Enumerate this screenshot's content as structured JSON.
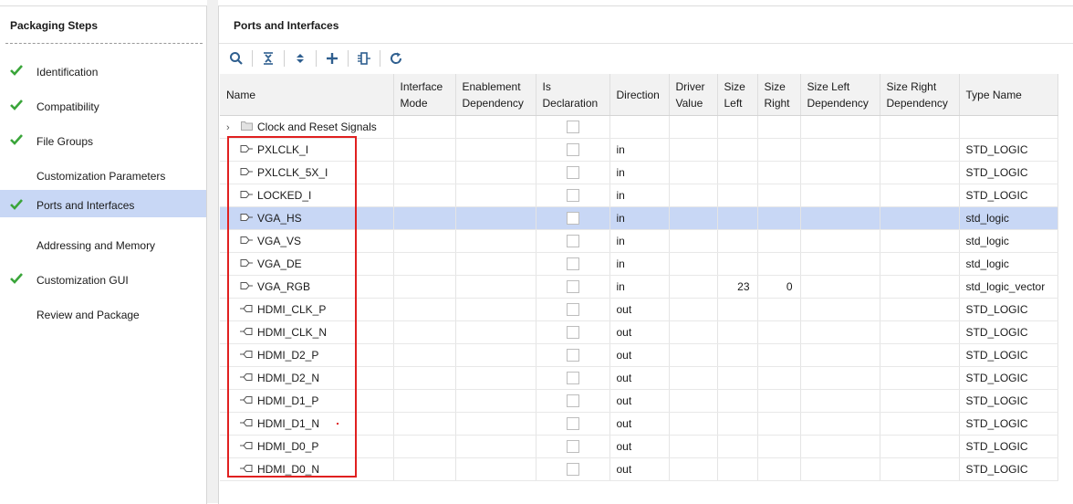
{
  "left_panel": {
    "title": "Packaging Steps",
    "steps": [
      {
        "label": "Identification",
        "checked": true,
        "selected": false
      },
      {
        "label": "Compatibility",
        "checked": true,
        "selected": false
      },
      {
        "label": "File Groups",
        "checked": true,
        "selected": false
      },
      {
        "label": "Customization Parameters",
        "checked": false,
        "selected": false
      },
      {
        "label": "Ports and Interfaces",
        "checked": true,
        "selected": true
      },
      {
        "label": "Addressing and Memory",
        "checked": false,
        "selected": false
      },
      {
        "label": "Customization GUI",
        "checked": true,
        "selected": false
      },
      {
        "label": "Review and Package",
        "checked": false,
        "selected": false
      }
    ]
  },
  "right_panel": {
    "title": "Ports and Interfaces",
    "toolbar": [
      "search-icon",
      "collapse-all-icon",
      "expand-all-icon",
      "add-icon",
      "map-ports-icon",
      "refresh-icon"
    ],
    "columns": [
      "Name",
      "Interface Mode",
      "Enablement Dependency",
      "Is Declaration",
      "Direction",
      "Driver Value",
      "Size Left",
      "Size Right",
      "Size Left Dependency",
      "Size Right Dependency",
      "Type Name"
    ],
    "group": {
      "name": "Clock and Reset Signals"
    },
    "rows": [
      {
        "name": "PXLCLK_I",
        "direction": "in",
        "size_left": "",
        "size_right": "",
        "type": "STD_LOGIC"
      },
      {
        "name": "PXLCLK_5X_I",
        "direction": "in",
        "size_left": "",
        "size_right": "",
        "type": "STD_LOGIC"
      },
      {
        "name": "LOCKED_I",
        "direction": "in",
        "size_left": "",
        "size_right": "",
        "type": "STD_LOGIC"
      },
      {
        "name": "VGA_HS",
        "direction": "in",
        "size_left": "",
        "size_right": "",
        "type": "std_logic",
        "selected": true
      },
      {
        "name": "VGA_VS",
        "direction": "in",
        "size_left": "",
        "size_right": "",
        "type": "std_logic"
      },
      {
        "name": "VGA_DE",
        "direction": "in",
        "size_left": "",
        "size_right": "",
        "type": "std_logic"
      },
      {
        "name": "VGA_RGB",
        "direction": "in",
        "size_left": "23",
        "size_right": "0",
        "type": "std_logic_vector"
      },
      {
        "name": "HDMI_CLK_P",
        "direction": "out",
        "size_left": "",
        "size_right": "",
        "type": "STD_LOGIC"
      },
      {
        "name": "HDMI_CLK_N",
        "direction": "out",
        "size_left": "",
        "size_right": "",
        "type": "STD_LOGIC"
      },
      {
        "name": "HDMI_D2_P",
        "direction": "out",
        "size_left": "",
        "size_right": "",
        "type": "STD_LOGIC"
      },
      {
        "name": "HDMI_D2_N",
        "direction": "out",
        "size_left": "",
        "size_right": "",
        "type": "STD_LOGIC"
      },
      {
        "name": "HDMI_D1_P",
        "direction": "out",
        "size_left": "",
        "size_right": "",
        "type": "STD_LOGIC"
      },
      {
        "name": "HDMI_D1_N",
        "direction": "out",
        "size_left": "",
        "size_right": "",
        "type": "STD_LOGIC"
      },
      {
        "name": "HDMI_D0_P",
        "direction": "out",
        "size_left": "",
        "size_right": "",
        "type": "STD_LOGIC"
      },
      {
        "name": "HDMI_D0_N",
        "direction": "out",
        "size_left": "",
        "size_right": "",
        "type": "STD_LOGIC"
      }
    ]
  },
  "colors": {
    "selection": "#c8d7f5",
    "check": "#3aa53a",
    "highlight_box": "#e02020",
    "toolbar_icon": "#2f5f8f"
  }
}
